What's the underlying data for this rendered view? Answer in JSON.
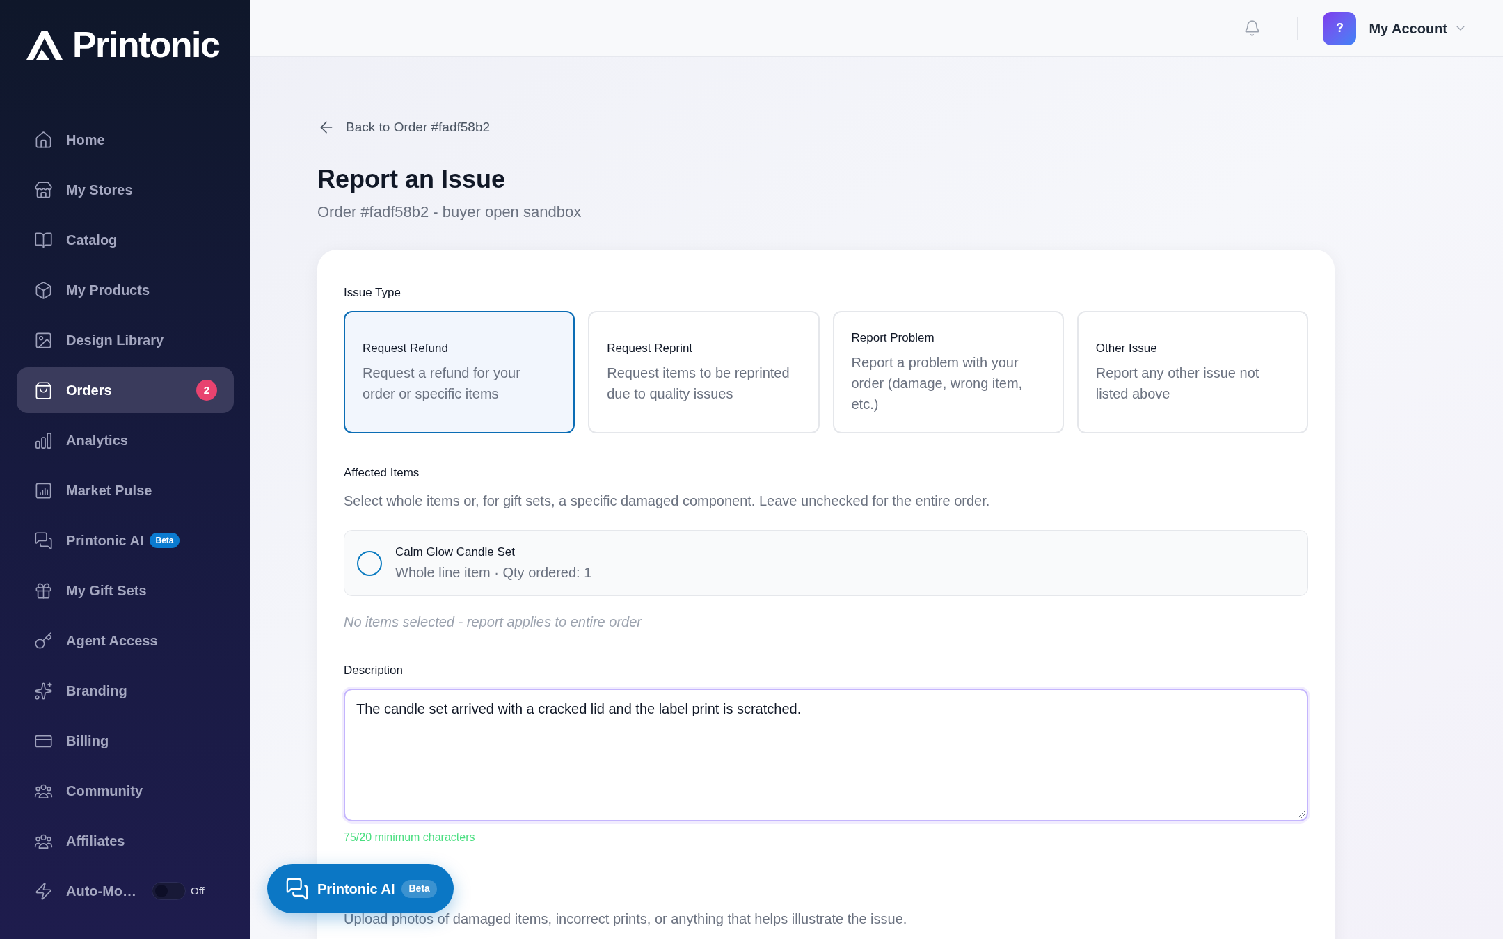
{
  "sidebar": {
    "logo": "Printonic",
    "items": [
      {
        "kind": "link",
        "label": "Home",
        "selected": false
      },
      {
        "kind": "link",
        "label": "My Stores",
        "selected": false
      },
      {
        "kind": "link",
        "label": "Catalog",
        "selected": false
      },
      {
        "kind": "link",
        "label": "My Products",
        "selected": false
      },
      {
        "kind": "link",
        "label": "Design Library",
        "selected": false
      },
      {
        "kind": "link",
        "label": "Orders",
        "selected": true,
        "badge": "2"
      },
      {
        "kind": "link",
        "label": "Analytics",
        "selected": false
      },
      {
        "kind": "link",
        "label": "Market Pulse",
        "selected": false
      },
      {
        "kind": "link",
        "label": "Printonic AI",
        "selected": false,
        "tag": "Beta"
      },
      {
        "kind": "link",
        "label": "My Gift Sets",
        "selected": false
      },
      {
        "kind": "link",
        "label": "Agent Access",
        "selected": false
      },
      {
        "kind": "link",
        "label": "Branding",
        "selected": false
      },
      {
        "kind": "link",
        "label": "Billing",
        "selected": false
      },
      {
        "kind": "link",
        "label": "Community",
        "selected": false
      },
      {
        "kind": "link",
        "label": "Affiliates",
        "selected": false
      },
      {
        "kind": "toggle",
        "label": "Auto-Mo…",
        "selected": false,
        "on": false,
        "state_label": "Off"
      }
    ]
  },
  "top_bar": {
    "account": {
      "avatar": "?",
      "label": "My Account"
    }
  },
  "back_link": "Back to Order #fadf58b2",
  "page": {
    "title": "Report an Issue",
    "subtitle": "Order #fadf58b2 - buyer open sandbox"
  },
  "form": {
    "issue_type": {
      "label": "Issue Type",
      "options": [
        {
          "title": "Request Refund",
          "description": "Request a refund for your order or specific items",
          "selected": true
        },
        {
          "title": "Request Reprint",
          "description": "Request items to be reprinted due to quality issues",
          "selected": false
        },
        {
          "title": "Report Problem",
          "description": "Report a problem with your order (damage, wrong item, etc.)",
          "selected": false
        },
        {
          "title": "Other Issue",
          "description": "Report any other issue not listed above",
          "selected": false
        }
      ]
    },
    "affected_items": {
      "label": "Affected Items",
      "hint": "Select whole items or, for gift sets, a specific damaged component. Leave unchecked for the entire order.",
      "items": [
        {
          "name": "Calm Glow Candle Set",
          "detail": "Whole line item · Qty ordered: 1",
          "checked": false
        }
      ],
      "empty_note": "No items selected - report applies to entire order"
    },
    "description": {
      "label": "Description",
      "value": "The candle set arrived with a cracked lid and the label print is scratched.",
      "counter": "75/20 minimum characters"
    },
    "photos": {
      "hint": "Upload photos of damaged items, incorrect prints, or anything that helps illustrate the issue."
    }
  },
  "assistant_button": {
    "label": "Printonic AI",
    "tag": "Beta"
  }
}
